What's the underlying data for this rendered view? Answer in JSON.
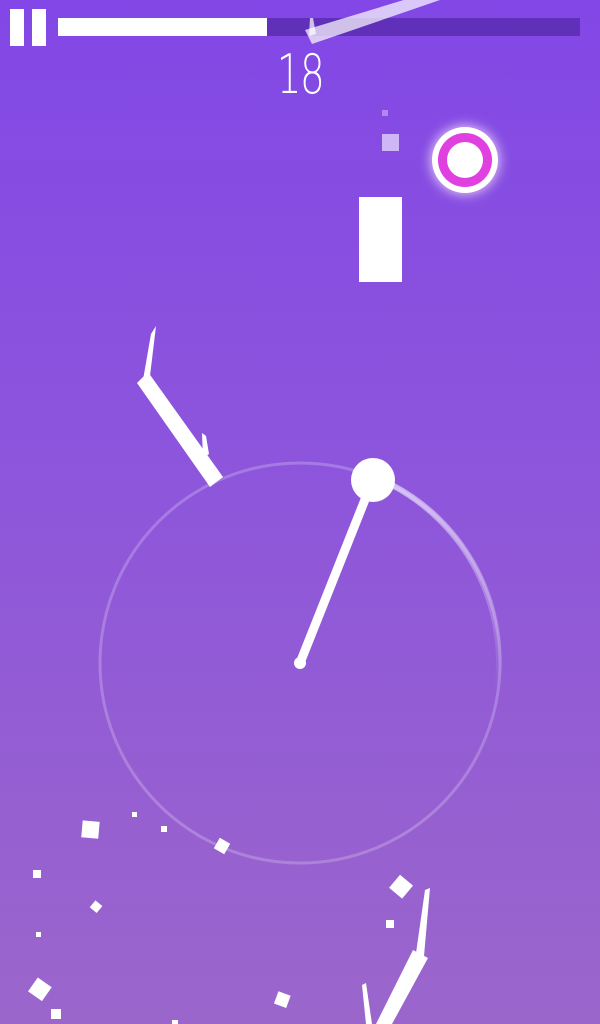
{
  "hud": {
    "score": "18",
    "progress": 0.4,
    "pause_icon": "pause-icon"
  },
  "colors": {
    "background_top": "#8247e6",
    "background_bottom": "#9b66cb",
    "target_ring": "#e040e0",
    "foreground": "#ffffff"
  }
}
